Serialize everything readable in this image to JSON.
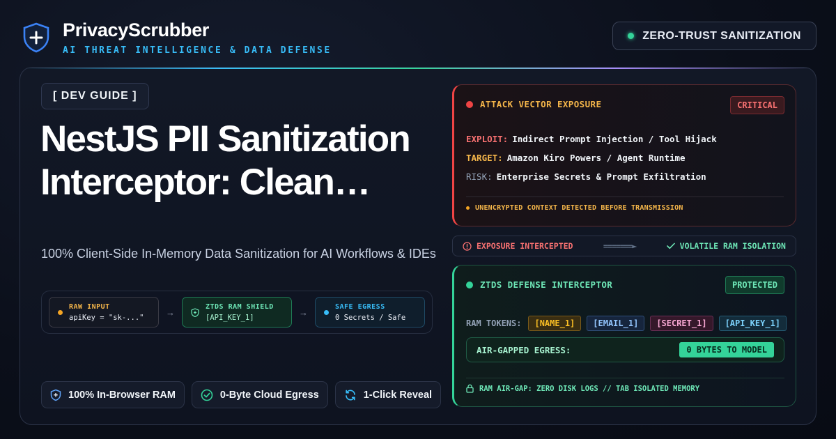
{
  "brand": {
    "name": "PrivacyScrubber",
    "tagline": "AI THREAT INTELLIGENCE & DATA DEFENSE"
  },
  "header": {
    "status_pill": "ZERO-TRUST SANITIZATION"
  },
  "hero": {
    "badge": "[ DEV GUIDE ]",
    "title": "NestJS PII Sanitization Interceptor: Clean…",
    "subtitle": "100% Client-Side In-Memory Data Sanitization for AI Workflows & IDEs"
  },
  "pipeline": {
    "stages": [
      {
        "title": "RAW INPUT",
        "value": "apiKey = \"sk-...\""
      },
      {
        "title": "ZTDS RAM SHIELD",
        "value": "[API_KEY_1]"
      },
      {
        "title": "SAFE EGRESS",
        "value": "0 Secrets / Safe"
      }
    ],
    "arrow": "→"
  },
  "features": [
    {
      "label": "100% In-Browser RAM",
      "icon": "shield-plus-icon"
    },
    {
      "label": "0-Byte Cloud Egress",
      "icon": "check-circle-icon"
    },
    {
      "label": "1-Click Reveal",
      "icon": "refresh-icon"
    }
  ],
  "attack": {
    "title": "ATTACK VECTOR EXPOSURE",
    "badge": "CRITICAL",
    "rows": [
      {
        "key": "EXPLOIT:",
        "value": "Indirect Prompt Injection / Tool Hijack"
      },
      {
        "key": "TARGET:",
        "value": "Amazon Kiro Powers / Agent Runtime"
      },
      {
        "key": "RISK:",
        "value": "Enterprise Secrets & Prompt Exfiltration"
      }
    ],
    "footer": "UNENCRYPTED CONTEXT DETECTED BEFORE TRANSMISSION"
  },
  "strip": {
    "left": "EXPOSURE INTERCEPTED",
    "middle": "=======►",
    "right": "VOLATILE RAM ISOLATION"
  },
  "defense": {
    "title": "ZTDS DEFENSE INTERCEPTOR",
    "badge": "PROTECTED",
    "tokens_label": "RAM TOKENS:",
    "tokens": [
      "[NAME_1]",
      "[EMAIL_1]",
      "[SECRET_1]",
      "[API_KEY_1]"
    ],
    "egress_label": "AIR-GAPPED EGRESS:",
    "egress_value": "0 BYTES TO MODEL",
    "footer": "RAM AIR-GAP: ZERO DISK LOGS // TAB ISOLATED MEMORY"
  },
  "colors": {
    "accent_sky": "#38bdf8",
    "accent_green": "#34d399",
    "critical_red": "#ef4444",
    "warning_amber": "#f5b64a"
  }
}
